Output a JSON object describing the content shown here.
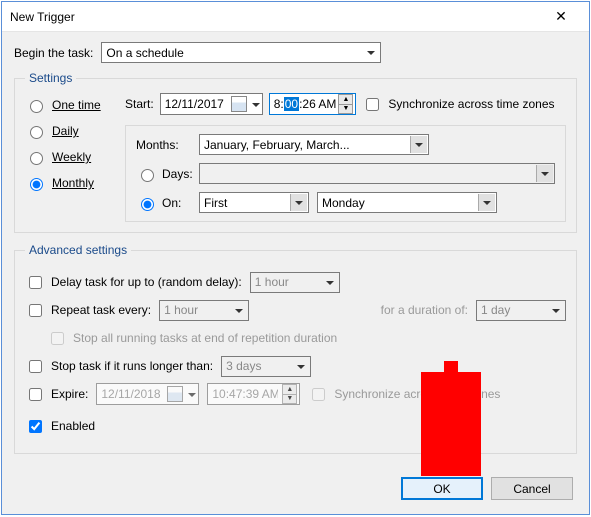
{
  "window": {
    "title": "New Trigger"
  },
  "begin": {
    "label": "Begin the task:",
    "value": "On a schedule"
  },
  "settings": {
    "legend": "Settings",
    "radios": {
      "one_time": "One time",
      "daily": "Daily",
      "weekly": "Weekly",
      "monthly": "Monthly",
      "selected": "monthly"
    },
    "start": {
      "label": "Start:",
      "date": "12/11/2017",
      "time_prefix": "8:",
      "time_highlight": "00",
      "time_suffix": ":26 AM",
      "sync_label": "Synchronize across time zones",
      "sync_checked": false
    },
    "months": {
      "label": "Months:",
      "value": "January, February, March..."
    },
    "days": {
      "label": "Days:",
      "selected": false
    },
    "on": {
      "label": "On:",
      "selected": true,
      "ordinal": "First",
      "weekday": "Monday"
    }
  },
  "advanced": {
    "legend": "Advanced settings",
    "delay": {
      "label": "Delay task for up to (random delay):",
      "checked": false,
      "value": "1 hour"
    },
    "repeat": {
      "label": "Repeat task every:",
      "checked": false,
      "value": "1 hour",
      "duration_label": "for a duration of:",
      "duration_value": "1 day",
      "stop_label": "Stop all running tasks at end of repetition duration",
      "stop_checked": false
    },
    "stop_if": {
      "label": "Stop task if it runs longer than:",
      "checked": false,
      "value": "3 days"
    },
    "expire": {
      "label": "Expire:",
      "checked": false,
      "date": "12/11/2018",
      "time": "10:47:39 AM",
      "sync_label": "Synchronize across time zones",
      "sync_checked": false
    },
    "enabled": {
      "label": "Enabled",
      "checked": true
    }
  },
  "buttons": {
    "ok": "OK",
    "cancel": "Cancel"
  }
}
